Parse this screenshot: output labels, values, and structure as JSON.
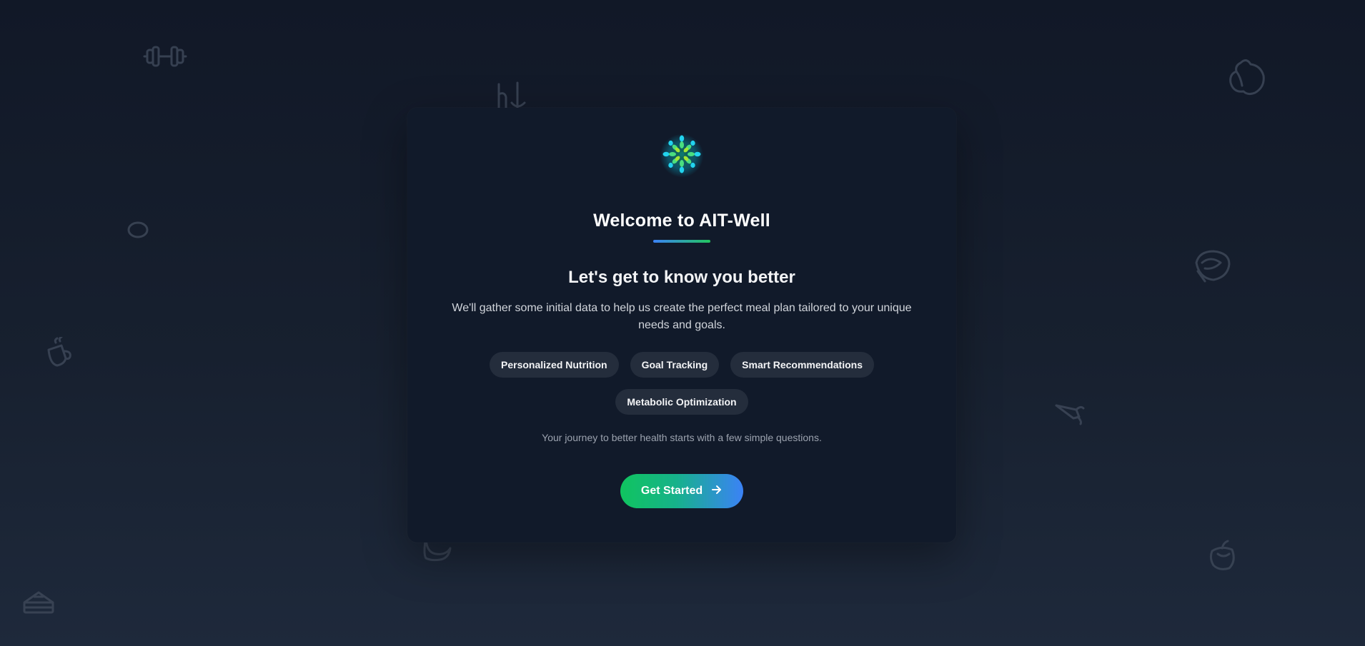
{
  "card": {
    "title": "Welcome to AIT-Well",
    "subtitle": "Let's get to know you better",
    "description": "We'll gather some initial data to help us create the perfect meal plan tailored to your unique needs and goals.",
    "tags": [
      "Personalized Nutrition",
      "Goal Tracking",
      "Smart Recommendations",
      "Metabolic Optimization"
    ],
    "tagline": "Your journey to better health starts with a few simple questions.",
    "cta_label": "Get Started",
    "cta_icon": "arrow-right-icon"
  },
  "logo_icon": "flower-logo-icon",
  "background_icons": [
    "dumbbell-icon",
    "utensils-icon",
    "apple-icon",
    "egg-icon",
    "salad-icon",
    "coffee-cup-icon",
    "carrot-icon",
    "chat-bubble-icon",
    "cake-slice-icon",
    "fruit-basket-icon"
  ],
  "colors": {
    "background_top": "#111827",
    "background_bottom": "#1e293b",
    "card": "#111a2a",
    "tag_bg": "#242d3c",
    "accent_green": "#10c45f",
    "accent_blue": "#3b82f6"
  }
}
